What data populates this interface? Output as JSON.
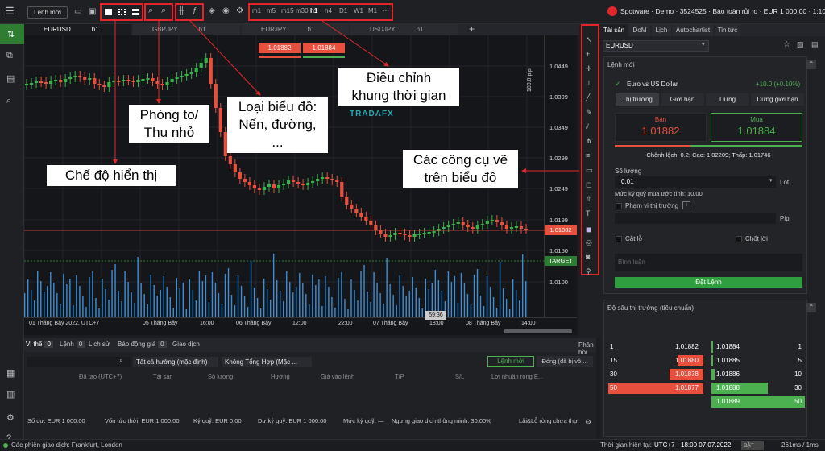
{
  "toolbar": {
    "new_order": "Lệnh mới",
    "timeframes": [
      "m1",
      "m5",
      "m15",
      "m30",
      "h1",
      "h4",
      "D1",
      "W1",
      "M1",
      "···"
    ],
    "account": "Spotware · Demo · 3524525 · Bảo toàn rủi ro · EUR 1 000.00 · 1:100"
  },
  "chart_tabs": [
    {
      "symbol": "EURUSD",
      "tf": "h1"
    },
    {
      "symbol": "GBPJPY",
      "tf": "h1"
    },
    {
      "symbol": "EURJPY",
      "tf": "h1"
    },
    {
      "symbol": "USDJPY",
      "tf": "h1"
    }
  ],
  "quick_trade": {
    "sell": "1.01882",
    "buy": "1.01884"
  },
  "price_axis": [
    "1.0449",
    "1.0399",
    "1.0349",
    "1.0299",
    "1.0249",
    "1.0199",
    "1.0150",
    "1.0100"
  ],
  "axis_unit": "100.0 pip",
  "current_price": "1.01882",
  "target_label": "TARGET",
  "countdown": "59:36",
  "time_axis": [
    "01 Tháng Bảy 2022, UTC+7",
    "05 Tháng Bảy",
    "16:00",
    "06 Tháng Bảy",
    "12:00",
    "22:00",
    "07 Tháng Bảy",
    "18:00",
    "08 Tháng Bảy",
    "14:00"
  ],
  "callouts": {
    "display_mode": "Chế độ hiển thị",
    "zoom": "Phóng to/\nThu nhỏ",
    "chart_type": "Loại biểu đồ:\nNến, đường, ...",
    "timeframe": "Điều chỉnh\nkhung thời gian",
    "drawing": "Các công cụ vẽ\ntrên biểu đồ"
  },
  "watermark": "TRADAFX",
  "panel": {
    "tabs": [
      "Tài sản",
      "DoM",
      "Lịch",
      "Autochartist",
      "Tin tức"
    ],
    "symbol": "EURUSD",
    "new_order": "Lệnh mới",
    "pair": "Euro vs US Dollar",
    "change": "+10.0 (+0.10%)",
    "order_types": [
      "Thị trường",
      "Giới hạn",
      "Dừng",
      "Dừng giới hạn"
    ],
    "sell_label": "Bán",
    "sell_price": "1.01882",
    "buy_label": "Mua",
    "buy_price": "1.01884",
    "spread": "Chênh lệch: 0.2; Cao: 1.02209; Thấp: 1.01746",
    "qty_label": "Số lượng",
    "qty": "0.01",
    "lot": "Lot",
    "margin": "Mức ký quỹ mua ước tính: 10.00",
    "range": "Phạm vi thị trường",
    "pip": "Pip",
    "sl": "Cắt lỗ",
    "tp": "Chốt lời",
    "comment": "Bình luận",
    "place": "Đặt Lệnh",
    "dom_title": "Độ sâu thị trường (tiêu chuẩn)",
    "dom_bids": [
      {
        "q": "1",
        "p": "1.01882"
      },
      {
        "q": "15",
        "p": "1.01880"
      },
      {
        "q": "30",
        "p": "1.01878"
      },
      {
        "q": "50",
        "p": "1.01877"
      }
    ],
    "dom_asks": [
      {
        "p": "1.01884",
        "q": "1"
      },
      {
        "p": "1.01885",
        "q": "5"
      },
      {
        "p": "1.01886",
        "q": "10"
      },
      {
        "p": "1.01888",
        "q": "30"
      },
      {
        "p": "1.01889",
        "q": "50"
      }
    ]
  },
  "bottom": {
    "tabs": [
      {
        "l": "Vị thế",
        "n": "0"
      },
      {
        "l": "Lệnh",
        "n": "0"
      },
      {
        "l": "Lịch sử",
        "n": ""
      },
      {
        "l": "Báo động giá",
        "n": "0"
      },
      {
        "l": "Giao dịch",
        "n": ""
      }
    ],
    "feedback": "Phản hồi",
    "filter1": "Tất cả hướng (mặc định)",
    "filter2": "Không Tổng Hợp (Mặc ...",
    "new_order": "Lệnh mới",
    "close": "Đóng (đã bị vô ...",
    "columns": [
      "Đã tạo (UTC+7)",
      "Tài sản",
      "Số lượng",
      "Hướng",
      "Giá vào lệnh",
      "T/P",
      "S/L",
      "Lợi nhuận ròng E..."
    ],
    "summary": [
      "Số dư: EUR 1 000.00",
      "Vốn tức thời: EUR 1 000.00",
      "Ký quỹ: EUR 0.00",
      "Dư ký quỹ: EUR 1 000.00",
      "Mức ký quỹ: —",
      "Ngưng giao dịch thông minh: 30.00%",
      "Lãi&Lỗ ròng chưa thự"
    ]
  },
  "status": {
    "sessions": "Các phiên giao dịch: Frankfurt, London",
    "time_label": "Thời gian hiện tại:",
    "tz": "UTC+7",
    "time": "18:00 07.07.2022",
    "toggle": "BẬT",
    "latency": "261ms / 1ms"
  }
}
